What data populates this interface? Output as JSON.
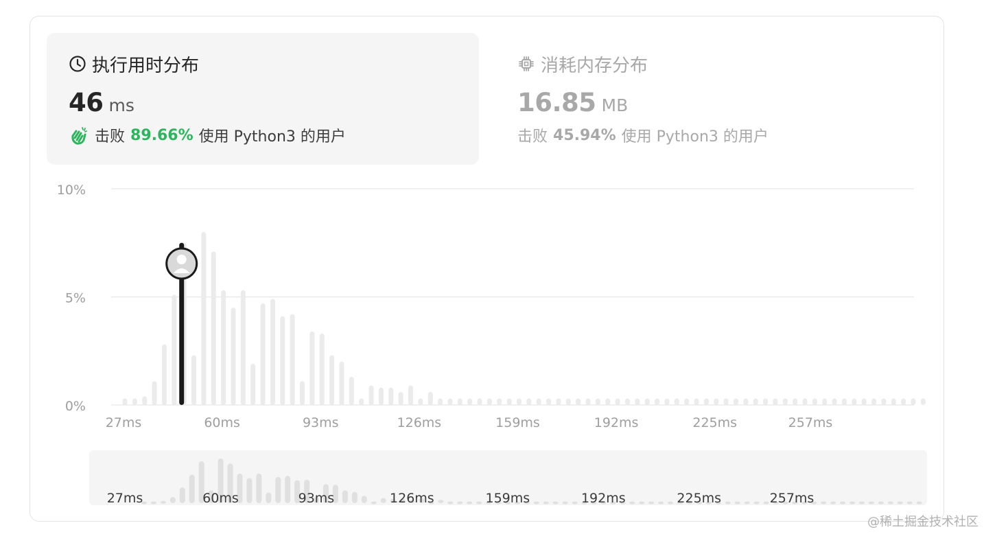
{
  "runtime": {
    "title": "执行用时分布",
    "value": "46",
    "unit": "ms",
    "beat_label": "击败",
    "beat_percent": "89.66%",
    "beat_suffix": "使用 Python3 的用户",
    "icon": "clock-icon"
  },
  "memory": {
    "title": "消耗内存分布",
    "value": "16.85",
    "unit": "MB",
    "beat_label": "击败",
    "beat_percent": "45.94%",
    "beat_suffix": "使用 Python3 的用户",
    "icon": "chip-icon"
  },
  "colors": {
    "bar": "#ebebeb",
    "highlight": "#1a1a1a",
    "beat_green": "#2db55d",
    "grid": "#e6e6e6",
    "label": "#9e9e9e"
  },
  "watermark": "@稀土掘金技术社区",
  "chart_data": {
    "type": "bar",
    "title": "",
    "xlabel": "",
    "ylabel": "",
    "ylim": [
      0,
      10
    ],
    "y_ticks": [
      "0%",
      "5%",
      "10%"
    ],
    "y_tick_values": [
      0,
      5,
      10
    ],
    "x_tick_labels": [
      "27ms",
      "60ms",
      "93ms",
      "126ms",
      "159ms",
      "192ms",
      "225ms",
      "257ms"
    ],
    "x_tick_positions": [
      27,
      60,
      93,
      126,
      159,
      192,
      225,
      257
    ],
    "bar_start": 27,
    "bar_step": 3.3,
    "highlight_x": 46,
    "grid": true,
    "values": [
      0.3,
      0.3,
      0.4,
      1.1,
      2.8,
      5.1,
      7.5,
      2.3,
      8.0,
      7.1,
      5.3,
      4.5,
      5.3,
      1.9,
      4.7,
      4.9,
      4.1,
      4.2,
      1.1,
      3.4,
      3.3,
      2.3,
      2.0,
      1.3,
      0.3,
      0.9,
      0.8,
      0.8,
      0.6,
      0.9,
      0.3,
      0.6,
      0.3,
      0.3,
      0.3,
      0.3,
      0.3,
      0.3,
      0.3,
      0.3,
      0.3,
      0.3,
      0.3,
      0.3,
      0.3,
      0.3,
      0.3,
      0.3,
      0.3,
      0.3,
      0.3,
      0.3,
      0.3,
      0.3,
      0.3,
      0.3,
      0.3,
      0.3,
      0.3,
      0.3,
      0.3,
      0.3,
      0.3,
      0.3,
      0.3,
      0.3,
      0.3,
      0.3,
      0.3,
      0.3,
      0.3,
      0.3,
      0.3,
      0.3,
      0.3,
      0.3,
      0.3,
      0.3,
      0.3,
      0.3,
      0.3,
      0.3
    ]
  }
}
